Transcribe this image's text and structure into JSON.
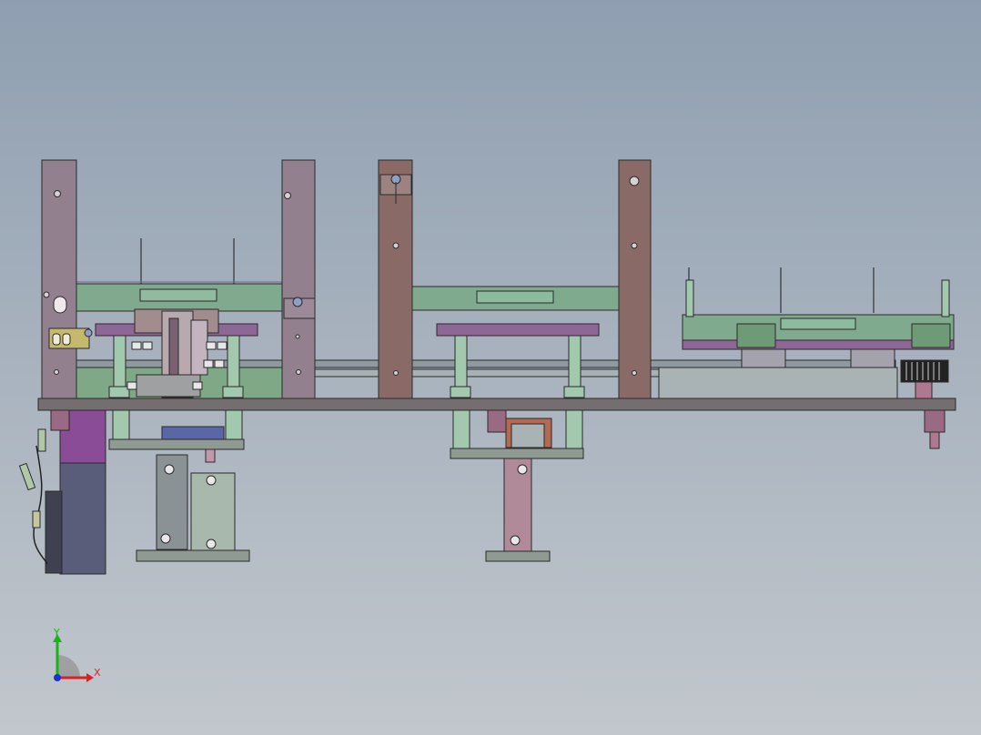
{
  "triad": {
    "y_label": "Y",
    "x_label": "X",
    "colors": {
      "y": "#18b418",
      "x": "#e02020",
      "z": "#2030d0"
    }
  },
  "palette": {
    "post_purple": "#93808f",
    "post_brown": "#8a6a66",
    "base_plate": "#756e70",
    "green_plate": "#7faa8e",
    "green_light": "#a2c8ae",
    "purple_bar": "#8e6796",
    "steel_grey": "#8b9296",
    "motor_dark": "#5a5d7a",
    "outline": "#2a2a2a"
  }
}
